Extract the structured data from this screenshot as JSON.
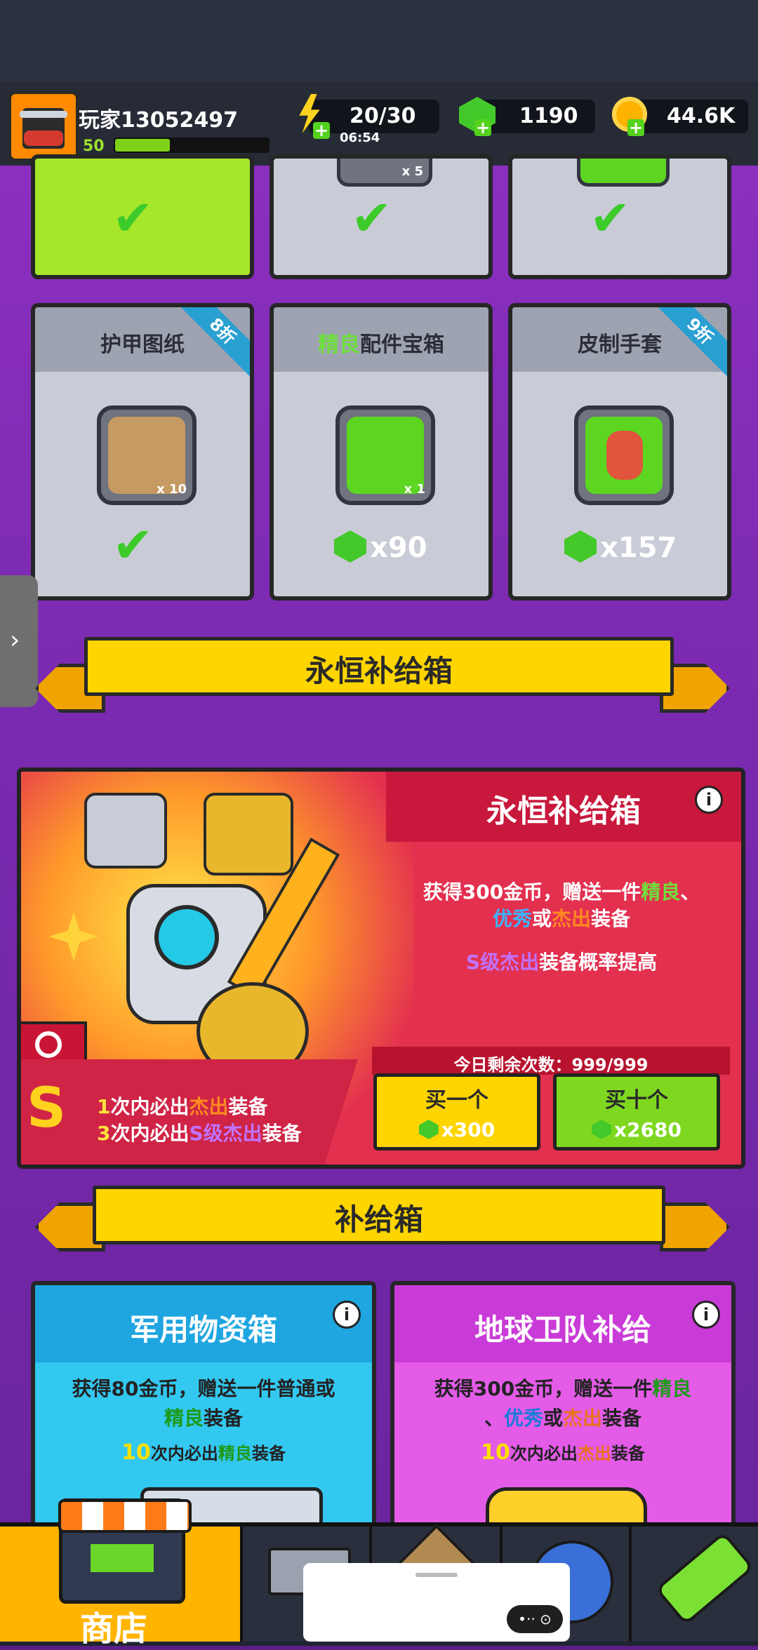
{
  "header": {
    "player_name": "玩家13052497",
    "level": "50",
    "xp_fraction": 0.36,
    "energy": "20/30",
    "energy_timer": "06:54",
    "gems": "1190",
    "coins": "44.6K"
  },
  "top_cards": {
    "items": [
      {
        "title": "",
        "status": "purchased"
      },
      {
        "title": "",
        "count": "x 5",
        "status": "purchased"
      },
      {
        "title": "",
        "status": "purchased"
      }
    ]
  },
  "offer_cards": [
    {
      "title": "护甲图纸",
      "discount": "8折",
      "count": "x 10",
      "status": "purchased"
    },
    {
      "title_prefix": "精良",
      "title_rest": "配件宝箱",
      "count": "x 1",
      "price": "x90"
    },
    {
      "title": "皮制手套",
      "discount": "9折",
      "price": "x157"
    }
  ],
  "eternal_section": {
    "banner": "永恒补给箱",
    "card_title": "永恒补给箱",
    "info": "i",
    "desc_line1_a": "获得300金币，赠送一件",
    "desc_line1_b": "精良",
    "desc_line1_c": "、",
    "desc_line2_a": "优秀",
    "desc_line2_b": "或",
    "desc_line2_c": "杰出",
    "desc_line2_d": "装备",
    "desc_line3_a": "S级杰出",
    "desc_line3_b": "装备概率提高",
    "remaining": "今日剩余次数：999/999",
    "guarantee1_num": "1",
    "guarantee1_a": "次内必出",
    "guarantee1_b": "杰出",
    "guarantee1_c": "装备",
    "guarantee2_num": "3",
    "guarantee2_a": "次内必出",
    "guarantee2_b": "S级杰出",
    "guarantee2_c": "装备",
    "buy_one_label": "买一个",
    "buy_one_price": "x300",
    "buy_ten_label": "买十个",
    "buy_ten_price": "x2680"
  },
  "supply_section": {
    "banner": "补给箱",
    "box1": {
      "title": "军用物资箱",
      "desc_a": "获得80金币，赠送一件普通或",
      "desc_b": "精良",
      "desc_c": "装备",
      "guarantee_num": "10",
      "guarantee_a": "次内必出",
      "guarantee_b": "精良",
      "guarantee_c": "装备"
    },
    "box2": {
      "title": "地球卫队补给",
      "desc_a": "获得300金币，赠送一件",
      "desc_b": "精良",
      "desc_c": "、",
      "desc_d": "优秀",
      "desc_e": "或",
      "desc_f": "杰出",
      "desc_g": "装备",
      "guarantee_num": "10",
      "guarantee_a": "次内必出",
      "guarantee_b": "杰出",
      "guarantee_c": "装备"
    }
  },
  "bottom_nav": {
    "shop_label": "商店"
  },
  "icons": {
    "energy": "lightning-icon",
    "gem": "gem-icon",
    "coin": "coin-icon",
    "check": "checkmark-icon",
    "search": "magnifier-icon"
  },
  "colors": {
    "accent_yellow": "#ffd500",
    "gem_green": "#44c92a",
    "eternal_red": "#e3304f",
    "supply_blue": "#33c8f0",
    "supply_pink": "#e45be8"
  }
}
